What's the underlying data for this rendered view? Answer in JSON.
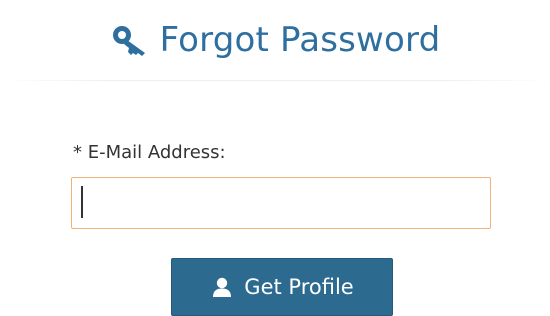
{
  "header": {
    "title": "Forgot Password",
    "icon": "key-icon"
  },
  "form": {
    "email_label": "* E-Mail Address:",
    "email_value": "",
    "email_placeholder": ""
  },
  "actions": {
    "get_profile_label": "Get Profile",
    "get_profile_icon": "user-icon"
  },
  "colors": {
    "title": "#2f6f9f",
    "input_focus_border": "#f0b27a",
    "button_bg": "#2d6a8f",
    "button_text": "#ffffff"
  }
}
